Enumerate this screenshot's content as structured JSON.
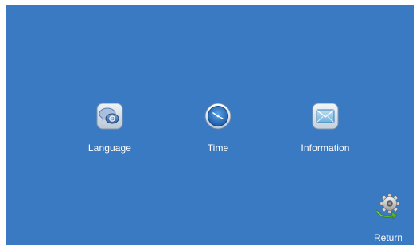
{
  "menu": {
    "items": [
      {
        "label": "Language",
        "icon": "language-chat-icon"
      },
      {
        "label": "Time",
        "icon": "clock-icon"
      },
      {
        "label": "Information",
        "icon": "envelope-icon"
      }
    ]
  },
  "footer": {
    "return_label": "Return",
    "return_icon": "gear-return-icon"
  },
  "colors": {
    "background": "#3a7ac2",
    "text": "#ffffff"
  }
}
